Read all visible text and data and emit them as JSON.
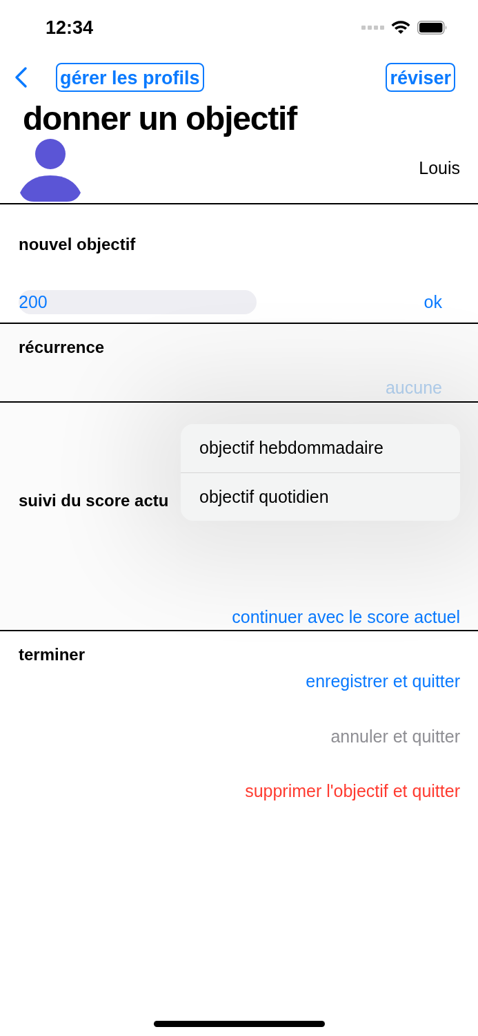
{
  "status_bar": {
    "time": "12:34"
  },
  "nav": {
    "manage_button": "gérer les profils",
    "review_button": "réviser"
  },
  "title": "donner un objectif",
  "profile": {
    "name": "Louis"
  },
  "new_goal": {
    "heading": "nouvel objectif",
    "field": {
      "value": "200"
    },
    "ok_button": "ok"
  },
  "recurrence": {
    "heading": "récurrence",
    "value": "aucune",
    "menu": [
      {
        "label": "objectif hebdommadaire"
      },
      {
        "label": "objectif quotidien"
      }
    ]
  },
  "tracking": {
    "heading": "suivi du score actu",
    "action": "continuer avec le score actuel"
  },
  "finish": {
    "heading": "terminer",
    "actions": [
      {
        "label": "enregistrer et quitter",
        "kind": "primary"
      },
      {
        "label": "annuler et quitter",
        "kind": "cancel"
      },
      {
        "label": "supprimer l'objectif et quitter",
        "kind": "destructive"
      }
    ]
  }
}
